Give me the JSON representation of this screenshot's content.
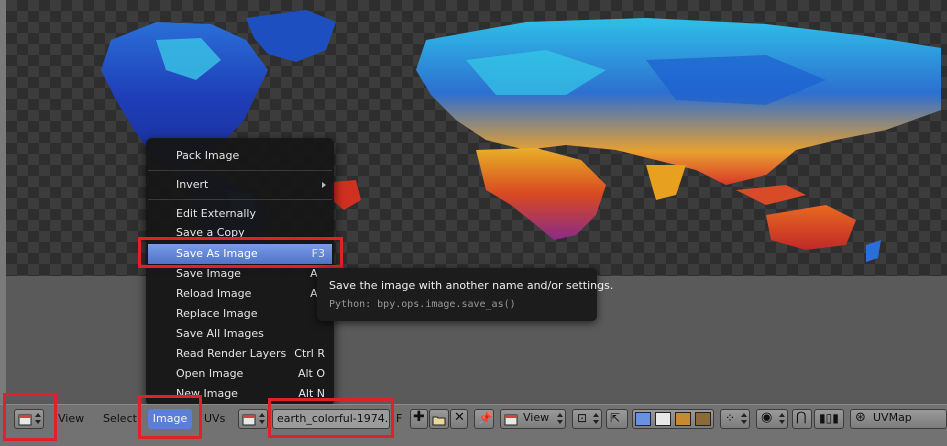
{
  "menu": {
    "items": {
      "pack": "Pack Image",
      "invert": "Invert",
      "edit_externally": "Edit Externally",
      "save_copy": "Save a Copy",
      "save_as": "Save As Image",
      "save_as_shortcut": "F3",
      "save": "Save Image",
      "save_shortcut": "Alt",
      "reload": "Reload Image",
      "reload_shortcut": "Alt",
      "replace": "Replace Image",
      "save_all": "Save All Images",
      "read_render_layers": "Read Render Layers",
      "read_render_layers_shortcut": "Ctrl R",
      "open": "Open Image",
      "open_shortcut": "Alt O",
      "new": "New Image",
      "new_shortcut": "Alt N"
    }
  },
  "tooltip": {
    "title": "Save the image with another name and/or settings.",
    "python": "Python: bpy.ops.image.save_as()"
  },
  "header": {
    "view": "View",
    "select": "Select",
    "image": "Image",
    "uvs": "UVs",
    "image_name": "earth_colorful-1974...",
    "fake_user": "F",
    "view_mode": "View",
    "uv_map": "UVMap"
  },
  "colors": {
    "highlight": "#5b7fd6",
    "red_annotation": "#e0202a",
    "header_bg": "#727272",
    "menu_bg": "#161616"
  }
}
